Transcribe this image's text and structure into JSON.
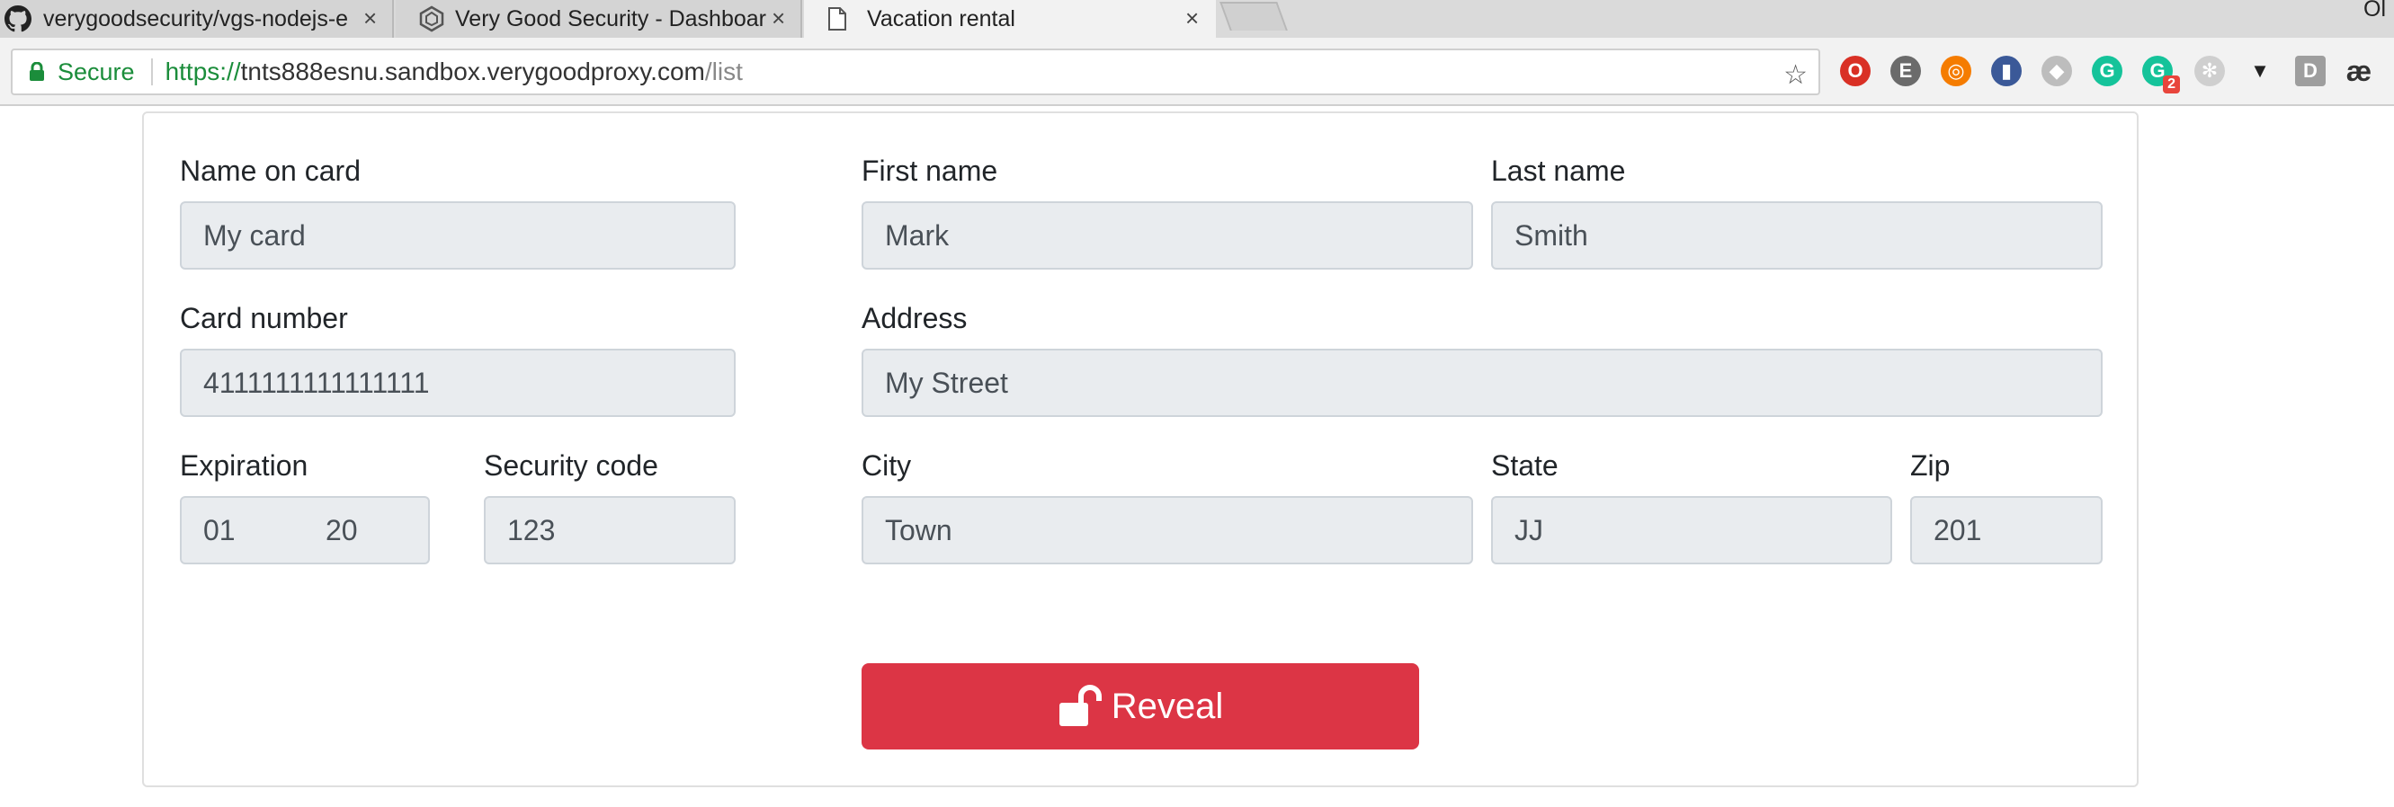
{
  "browser": {
    "tabs": [
      {
        "title": "verygoodsecurity/vgs-nodejs-e",
        "icon": "github-icon"
      },
      {
        "title": "Very Good Security - Dashboar",
        "icon": "vgs-hexagon-icon"
      },
      {
        "title": "Vacation rental",
        "icon": "page-icon"
      }
    ],
    "close_glyph": "×",
    "profile_name": "Ol",
    "address": {
      "security_label": "Secure",
      "scheme": "https://",
      "host": "tnts888esnu.sandbox.verygoodproxy.com",
      "path": "/list"
    },
    "extensions": [
      {
        "name": "opera-icon",
        "color": "#d93025",
        "glyph": "O"
      },
      {
        "name": "evernote-icon",
        "color": "#6b6b6b",
        "glyph": "E"
      },
      {
        "name": "lifebuoy-icon",
        "color": "#f57c00",
        "glyph": "◎"
      },
      {
        "name": "books-icon",
        "color": "#3b5998",
        "glyph": "▮"
      },
      {
        "name": "dropbox-icon",
        "color": "#bdbdbd",
        "glyph": "◆"
      },
      {
        "name": "grammarly-icon",
        "color": "#15c39a",
        "glyph": "G"
      },
      {
        "name": "grammarly-badge-icon",
        "color": "#15c39a",
        "glyph": "G",
        "badge": "2"
      },
      {
        "name": "snowflake-icon",
        "color": "#cfcfcf",
        "glyph": "✻"
      },
      {
        "name": "fox-icon",
        "color": "#222222",
        "glyph": "▼"
      },
      {
        "name": "d-icon",
        "color": "#9e9e9e",
        "glyph": "D"
      },
      {
        "name": "ae-icon",
        "color": "#333333",
        "glyph": "æ"
      }
    ]
  },
  "form": {
    "name_on_card": {
      "label": "Name on card",
      "value": "My card"
    },
    "card_number": {
      "label": "Card number",
      "value": "4111111111111111"
    },
    "expiration": {
      "label": "Expiration",
      "month": "01",
      "year": "20"
    },
    "security_code": {
      "label": "Security code",
      "value": "123"
    },
    "first_name": {
      "label": "First name",
      "value": "Mark"
    },
    "last_name": {
      "label": "Last name",
      "value": "Smith"
    },
    "address": {
      "label": "Address",
      "value": "My Street"
    },
    "city": {
      "label": "City",
      "value": "Town"
    },
    "state": {
      "label": "State",
      "value": "JJ"
    },
    "zip": {
      "label": "Zip",
      "value": "201"
    },
    "reveal_button": "Reveal"
  },
  "colors": {
    "reveal_button": "#dc3545",
    "secure_green": "#1b8d3b",
    "field_bg": "#e9ecef"
  }
}
